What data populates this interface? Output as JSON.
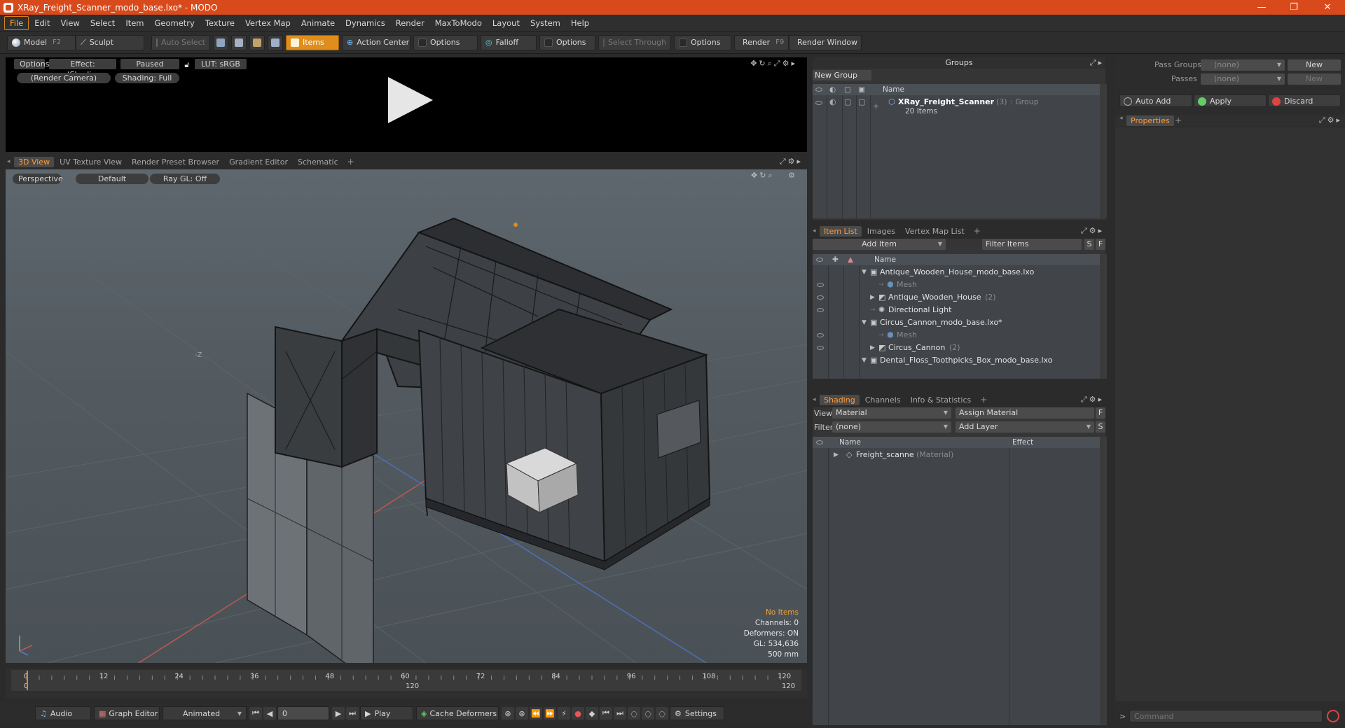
{
  "window": {
    "title": "XRay_Freight_Scanner_modo_base.lxo* - MODO",
    "minimize": "—",
    "restore": "❐",
    "close": "✕"
  },
  "menu": [
    "File",
    "Edit",
    "View",
    "Select",
    "Item",
    "Geometry",
    "Texture",
    "Vertex Map",
    "Animate",
    "Dynamics",
    "Render",
    "MaxToModo",
    "Layout",
    "System",
    "Help"
  ],
  "toolbar": {
    "model": "Model",
    "model_hotkey": "F2",
    "sculpt": "Sculpt",
    "auto_select": "Auto Select",
    "items": "Items",
    "action_center": "Action Center",
    "options_1": "Options",
    "falloff": "Falloff",
    "options_2": "Options",
    "select_through": "Select Through",
    "options_3": "Options",
    "render": "Render",
    "render_hotkey": "F9",
    "render_window": "Render Window"
  },
  "render_preview": {
    "options": "Options",
    "effect": "Effect: (Shadi...",
    "paused": "Paused",
    "lut": "LUT: sRGB",
    "camera": "(Render Camera)",
    "shading": "Shading: Full"
  },
  "viewport_tabs": [
    "3D View",
    "UV Texture View",
    "Render Preset Browser",
    "Gradient Editor",
    "Schematic"
  ],
  "viewport": {
    "perspective": "Perspective",
    "default": "Default",
    "raygl": "Ray GL: Off",
    "axis_label": "-Z",
    "stats": {
      "no_items": "No Items",
      "channels": "Channels: 0",
      "deformers": "Deformers: ON",
      "gl": "GL: 534,636",
      "scale": "500 mm"
    }
  },
  "timeline": {
    "ticks": [
      "0",
      "12",
      "24",
      "36",
      "48",
      "60",
      "72",
      "84",
      "96",
      "108",
      "120"
    ],
    "start": "0",
    "mid": "120",
    "end": "120"
  },
  "transport": {
    "audio": "Audio",
    "graph_editor": "Graph Editor",
    "animated": "Animated",
    "frame": "0",
    "play": "Play",
    "cache_deformers": "Cache Deformers",
    "settings": "Settings"
  },
  "groups": {
    "title": "Groups",
    "new_group": "New Group",
    "col_name": "Name",
    "group_name": "XRay_Freight_Scanner",
    "group_count": "(3)",
    "group_type": ": Group",
    "group_items": "20 Items"
  },
  "itemlist": {
    "tabs": [
      "Item List",
      "Images",
      "Vertex Map List"
    ],
    "add_item": "Add Item",
    "filter_items": "Filter Items",
    "s_btn": "S",
    "f_btn": "F",
    "col_name": "Name",
    "rows": [
      {
        "label": "Antique_Wooden_House_modo_base.lxo",
        "indent": 0,
        "dim": false,
        "suffix": ""
      },
      {
        "label": "Mesh",
        "indent": 2,
        "dim": true,
        "suffix": ""
      },
      {
        "label": "Antique_Wooden_House",
        "indent": 1,
        "dim": false,
        "suffix": "(2)"
      },
      {
        "label": "Directional Light",
        "indent": 1,
        "dim": false,
        "suffix": ""
      },
      {
        "label": "Circus_Cannon_modo_base.lxo*",
        "indent": 0,
        "dim": false,
        "suffix": ""
      },
      {
        "label": "Mesh",
        "indent": 2,
        "dim": true,
        "suffix": ""
      },
      {
        "label": "Circus_Cannon",
        "indent": 1,
        "dim": false,
        "suffix": "(2)"
      },
      {
        "label": "Dental_Floss_Toothpicks_Box_modo_base.lxo",
        "indent": 0,
        "dim": false,
        "suffix": ""
      }
    ]
  },
  "shading": {
    "tabs": [
      "Shading",
      "Channels",
      "Info & Statistics"
    ],
    "view_label": "View",
    "view_value": "Material",
    "assign_material": "Assign Material",
    "f_btn": "F",
    "filter_label": "Filter",
    "filter_value": "(none)",
    "add_layer": "Add Layer",
    "s_btn": "S",
    "col_name": "Name",
    "col_effect": "Effect",
    "material_name": "Freight_scanne",
    "material_type": "(Material)"
  },
  "properties": {
    "pass_groups_label": "Pass Groups",
    "pass_groups_value": "(none)",
    "new_1": "New",
    "passes_label": "Passes",
    "passes_value": "(none)",
    "new_2": "New",
    "auto_add": "Auto Add",
    "apply": "Apply",
    "discard": "Discard",
    "tab": "Properties",
    "command_placeholder": "Command"
  },
  "colors": {
    "accent": "#e08e1b",
    "titlebar": "#d84a1b",
    "viewport_bg": "#555d63"
  }
}
